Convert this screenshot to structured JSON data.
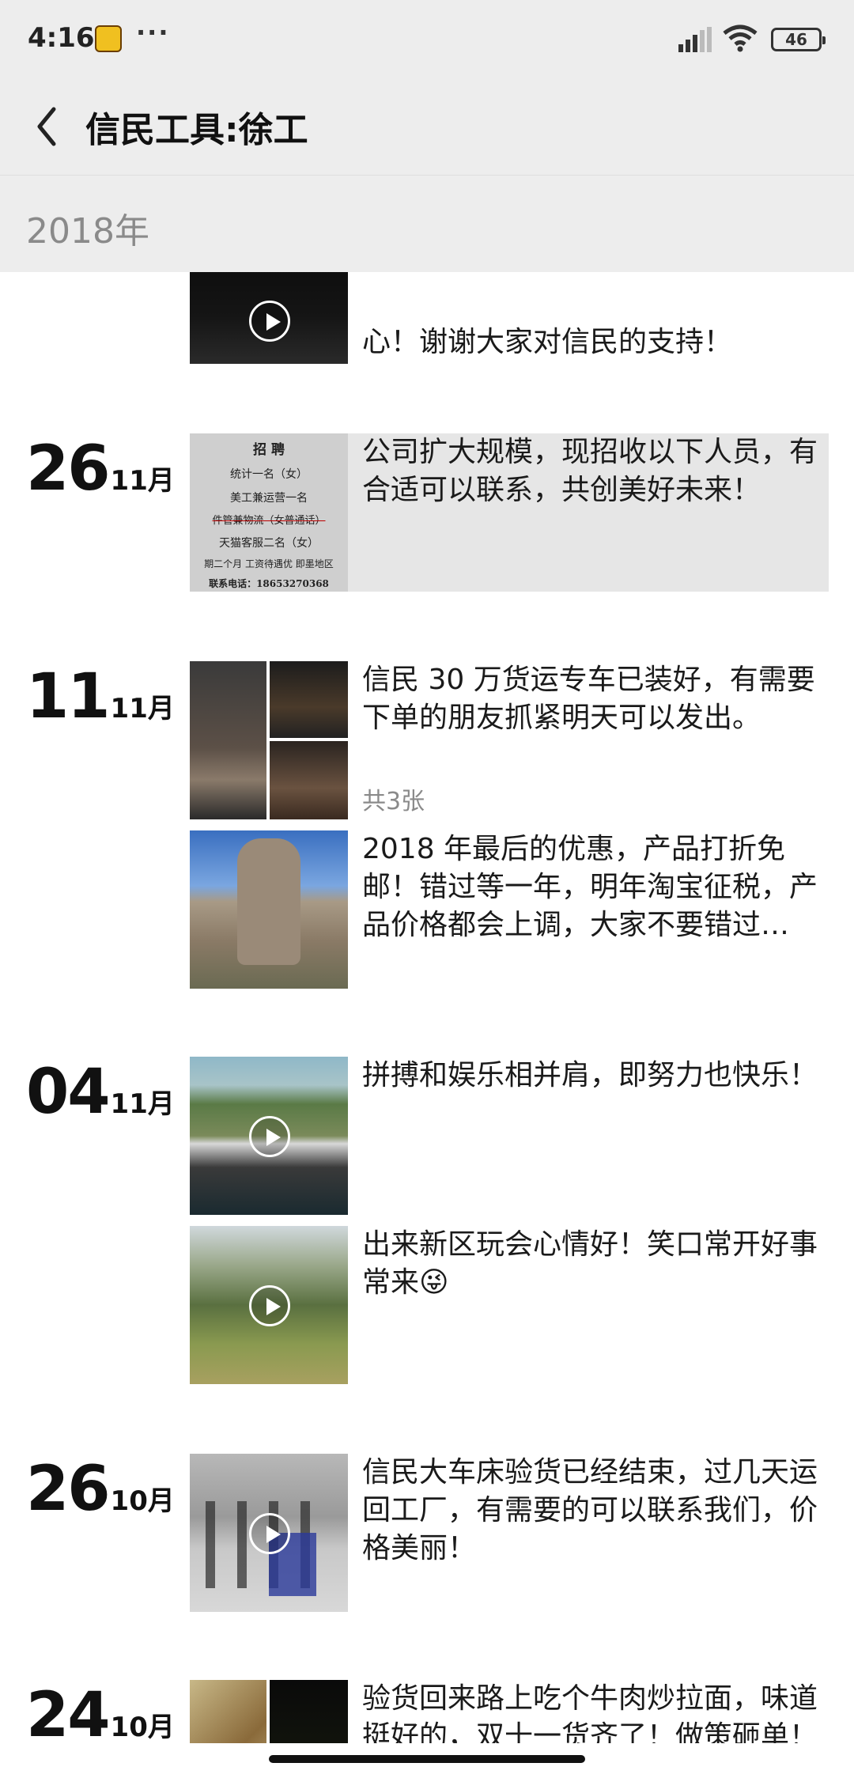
{
  "status_bar": {
    "time": "4:16",
    "more": "···",
    "battery": "46",
    "icons": [
      "app-icon",
      "signal-icon",
      "wifi-icon",
      "battery-icon"
    ]
  },
  "header": {
    "back_icon": "chevron-left-icon",
    "title": "信民工具:徐工"
  },
  "year_label": "2018年",
  "posts": [
    {
      "day": "",
      "month": "",
      "text": "心！谢谢大家对信民的支持！",
      "media": "video",
      "colors": [
        "#0b0b0b",
        "#1a1a1a"
      ]
    },
    {
      "day": "26",
      "month": "11月",
      "text": "公司扩大规模，现招收以下人员，有合适可以联系，共创美好未来！",
      "media": "image",
      "poster_lines": [
        "招 聘",
        "统计一名（女）",
        "美工兼运营一名",
        "件管兼物流（女普通话）",
        "天猫客服二名（女）",
        "期二个月 工资待遇优 即墨地区",
        "联系电话：18653270368"
      ]
    },
    {
      "day": "11",
      "month": "11月",
      "text": "信民 30 万货运专车已装好，有需要下单的朋友抓紧明天可以发出。",
      "media": "image-grid",
      "count": "共3张"
    },
    {
      "day": "",
      "month": "",
      "text": "2018 年最后的优惠，产品打折免邮！错过等一年，明年淘宝征税，产品价格都会上调，大家不要错过…",
      "media": "image"
    },
    {
      "day": "04",
      "month": "11月",
      "text": "拼搏和娱乐相并肩，即努力也快乐！",
      "media": "video"
    },
    {
      "day": "",
      "month": "",
      "text": "出来新区玩会心情好！笑口常开好事常来😜",
      "media": "video"
    },
    {
      "day": "26",
      "month": "10月",
      "text": "信民大车床验货已经结束，过几天运回工厂，有需要的可以联系我们，价格美丽！",
      "media": "video"
    },
    {
      "day": "24",
      "month": "10月",
      "text": "验货回来路上吃个牛肉炒拉面，味道挺好的，双十一货齐了！做策砸单！",
      "media": "image-grid"
    }
  ]
}
